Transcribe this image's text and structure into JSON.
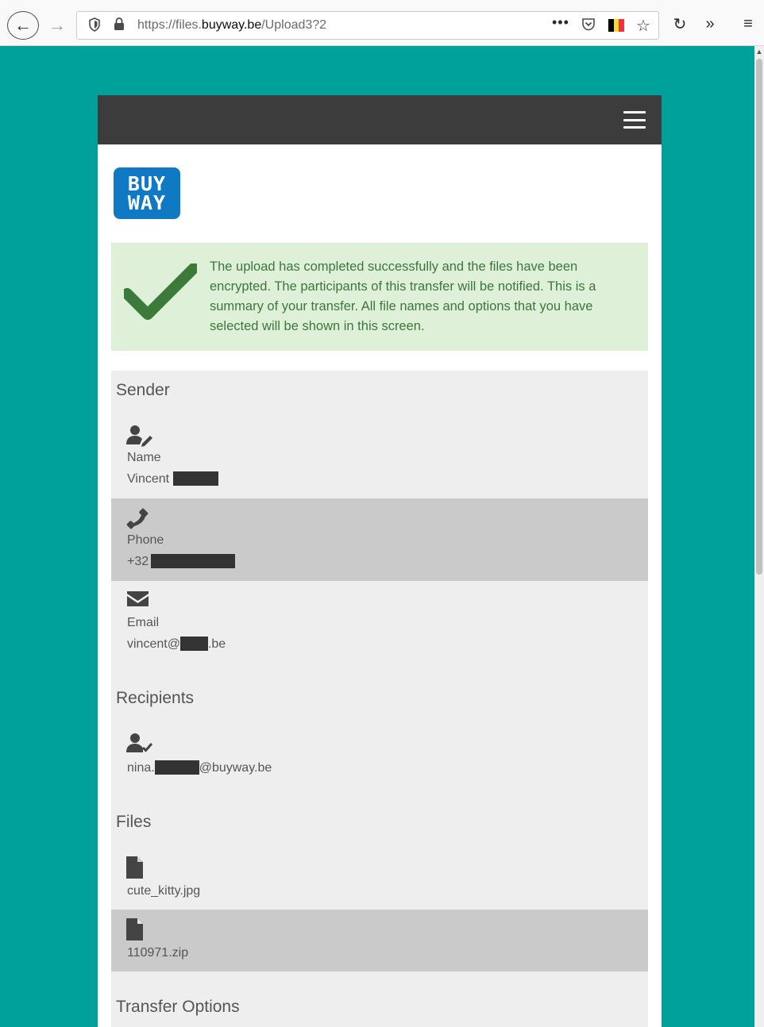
{
  "browser": {
    "url_prefix": "https://files.",
    "url_host": "buyway.be",
    "url_path": "/Upload3?2",
    "flag_colors": [
      "#000000",
      "#fdda24",
      "#ef3340"
    ]
  },
  "navbar": {
    "menu_icon": "hamburger-icon"
  },
  "logo": {
    "line1": "BUY",
    "line2": "WAY"
  },
  "alert": {
    "message": "The upload has completed successfully and the files have been encrypted. The participants of this transfer will be notified. This is a summary of your transfer. All file names and options that you have selected will be shown in this screen."
  },
  "sender": {
    "title": "Sender",
    "name_label": "Name",
    "name_value": "Vincent",
    "phone_label": "Phone",
    "phone_value": "+32",
    "email_label": "Email",
    "email_prefix": "vincent@",
    "email_suffix": ".be"
  },
  "recipients": {
    "title": "Recipients",
    "email_prefix": "nina.",
    "email_suffix": "@buyway.be"
  },
  "files": {
    "title": "Files",
    "items": [
      "cute_kitty.jpg",
      "110971.zip"
    ]
  },
  "transfer_options": {
    "title": "Transfer Options"
  },
  "colors": {
    "page_background": "#00a19a",
    "navbar": "#3c3c3c",
    "alert_background": "#dff0d8",
    "alert_text": "#3c763d",
    "checkmark": "#3c7a3c",
    "summary_background": "#eeeeee",
    "row_highlight": "#cacaca",
    "logo": "#0f79c4"
  }
}
